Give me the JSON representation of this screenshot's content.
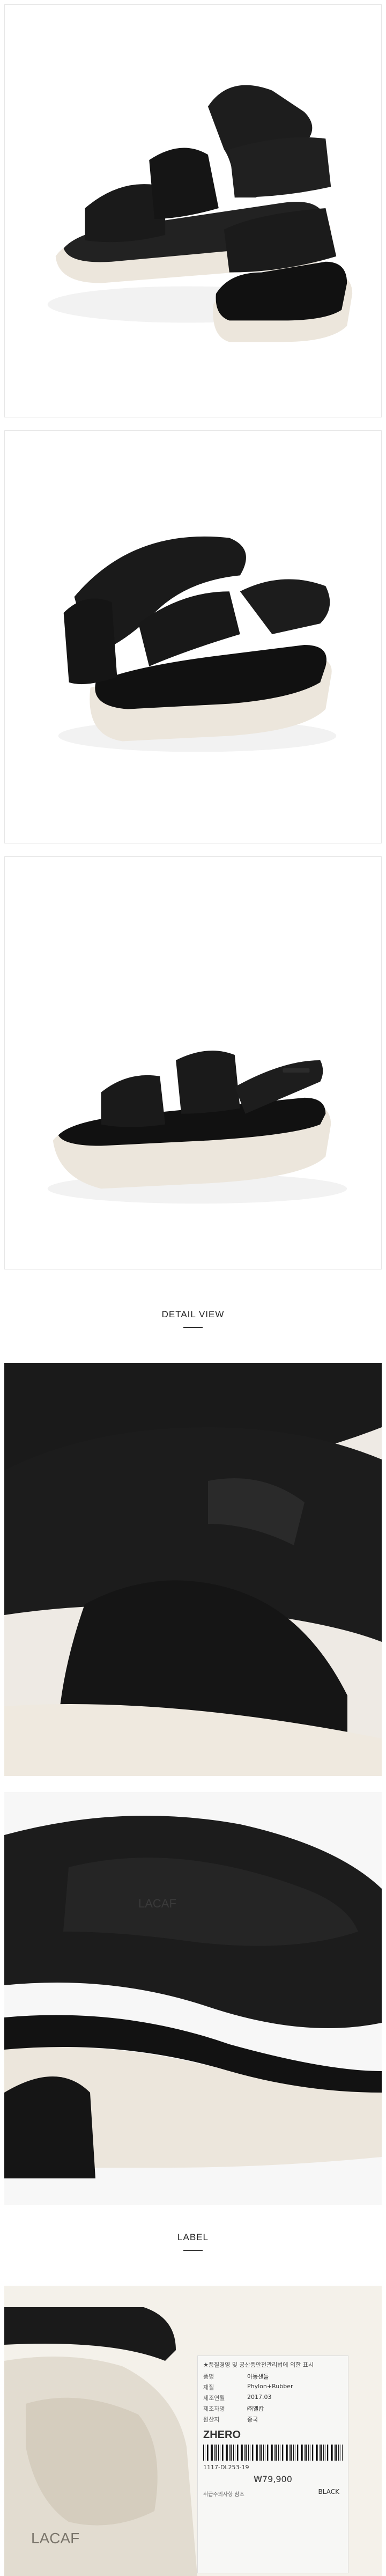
{
  "sections": {
    "detail_title": "DETAIL VIEW",
    "label_title": "LABEL"
  },
  "label": {
    "notice": "★품질경영 및 공산품안전관리법에 의한 표시",
    "rows": [
      {
        "k": "품명",
        "v": "아동샌들"
      },
      {
        "k": "재질",
        "v": "Phylon+Rubber"
      },
      {
        "k": "제조연월",
        "v": "2017.03"
      },
      {
        "k": "제조자명",
        "v": "㈜엘캅"
      },
      {
        "k": "원산지",
        "v": "중국"
      }
    ],
    "brand": "ZHERO",
    "color": "BLACK",
    "product_code": "1117-DL253-19",
    "price": "₩79,900",
    "footnote": "취급주의사항 참조"
  },
  "logo_text": "LACAF",
  "colors": {
    "leather": "#1a1a1a",
    "sole": "#ece6dc",
    "background": "#ffffff"
  }
}
